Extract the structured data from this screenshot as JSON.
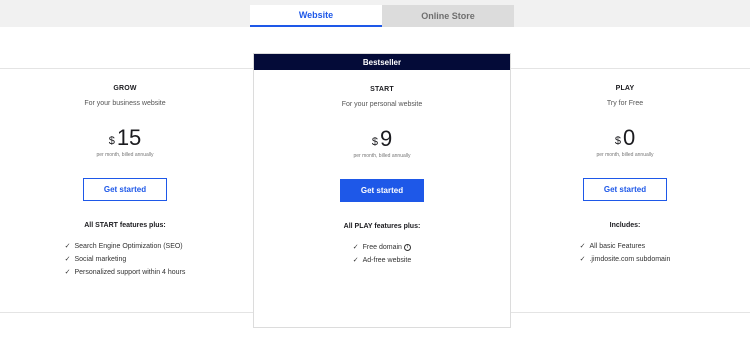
{
  "tabs": [
    {
      "label": "Website",
      "active": true
    },
    {
      "label": "Online Store",
      "active": false
    }
  ],
  "colors": {
    "accent": "#1e58e8",
    "banner": "#040b38"
  },
  "plans": {
    "grow": {
      "name": "GROW",
      "subtitle": "For your business website",
      "currency": "$",
      "price": "15",
      "billing": "per month, billed annually",
      "button": "Get started",
      "features_title": "All START features plus:",
      "features": [
        "Search Engine Optimization (SEO)",
        "Social marketing",
        "Personalized support within 4 hours"
      ]
    },
    "start": {
      "badge": "Bestseller",
      "name": "START",
      "subtitle": "For your personal website",
      "currency": "$",
      "price": "9",
      "billing": "per month, billed annually",
      "button": "Get started",
      "features_title": "All PLAY features plus:",
      "features": [
        "Free domain",
        "Ad-free website"
      ]
    },
    "play": {
      "name": "PLAY",
      "subtitle": "Try for Free",
      "currency": "$",
      "price": "0",
      "billing": "per month, billed annually",
      "button": "Get started",
      "features_title": "Includes:",
      "features": [
        "All basic Features",
        ".jimdosite.com subdomain"
      ]
    }
  },
  "icons": {
    "check": "check-icon",
    "info": "info-icon"
  }
}
